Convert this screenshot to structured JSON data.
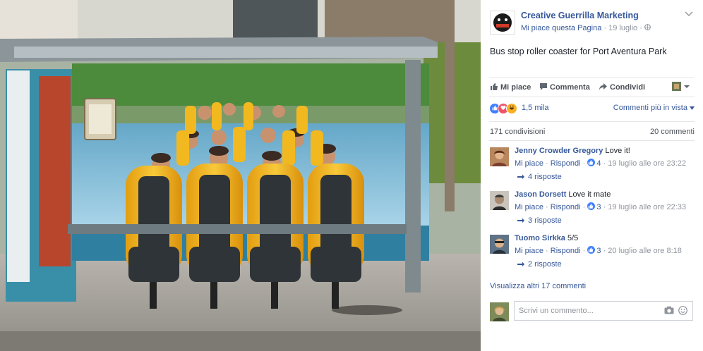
{
  "post": {
    "page_name": "Creative Guerrilla Marketing",
    "like_page": "Mi piace questa Pagina",
    "date": "19 luglio",
    "text": "Bus stop roller coaster for Port Aventura Park"
  },
  "actions": {
    "like": "Mi piace",
    "comment": "Commenta",
    "share": "Condividi"
  },
  "reactions": {
    "count": "1,5 mila",
    "sort": "Commenti più in vista"
  },
  "stats": {
    "shares": "171 condivisioni",
    "comments": "20 commenti"
  },
  "comments": [
    {
      "author": "Jenny Crowder Gregory",
      "text": "Love it!",
      "like": "Mi piace",
      "reply": "Rispondi",
      "likes": "4",
      "time": "19 luglio alle ore 23:22",
      "replies": "4 risposte"
    },
    {
      "author": "Jason Dorsett",
      "text": "Love it mate",
      "like": "Mi piace",
      "reply": "Rispondi",
      "likes": "3",
      "time": "19 luglio alle ore 22:33",
      "replies": "3 risposte"
    },
    {
      "author": "Tuomo Sirkka",
      "text": "5/5",
      "like": "Mi piace",
      "reply": "Rispondi",
      "likes": "3",
      "time": "20 luglio alle ore 8:18",
      "replies": "2 risposte"
    }
  ],
  "more_comments": "Visualizza altri 17 commenti",
  "write_comment": {
    "placeholder": "Scrivi un commento..."
  },
  "colors": {
    "link": "#365899",
    "like_blue": "#4080ff",
    "love_red": "#f25268",
    "haha_yellow": "#f7b125",
    "coaster_yellow": "#f2b820"
  },
  "icons": [
    "chevron-down-icon",
    "globe-icon",
    "thumbs-up-icon",
    "comment-icon",
    "share-arrow-icon",
    "camera-icon",
    "smiley-icon",
    "reaction-like-icon",
    "reaction-love-icon",
    "reaction-haha-icon"
  ]
}
